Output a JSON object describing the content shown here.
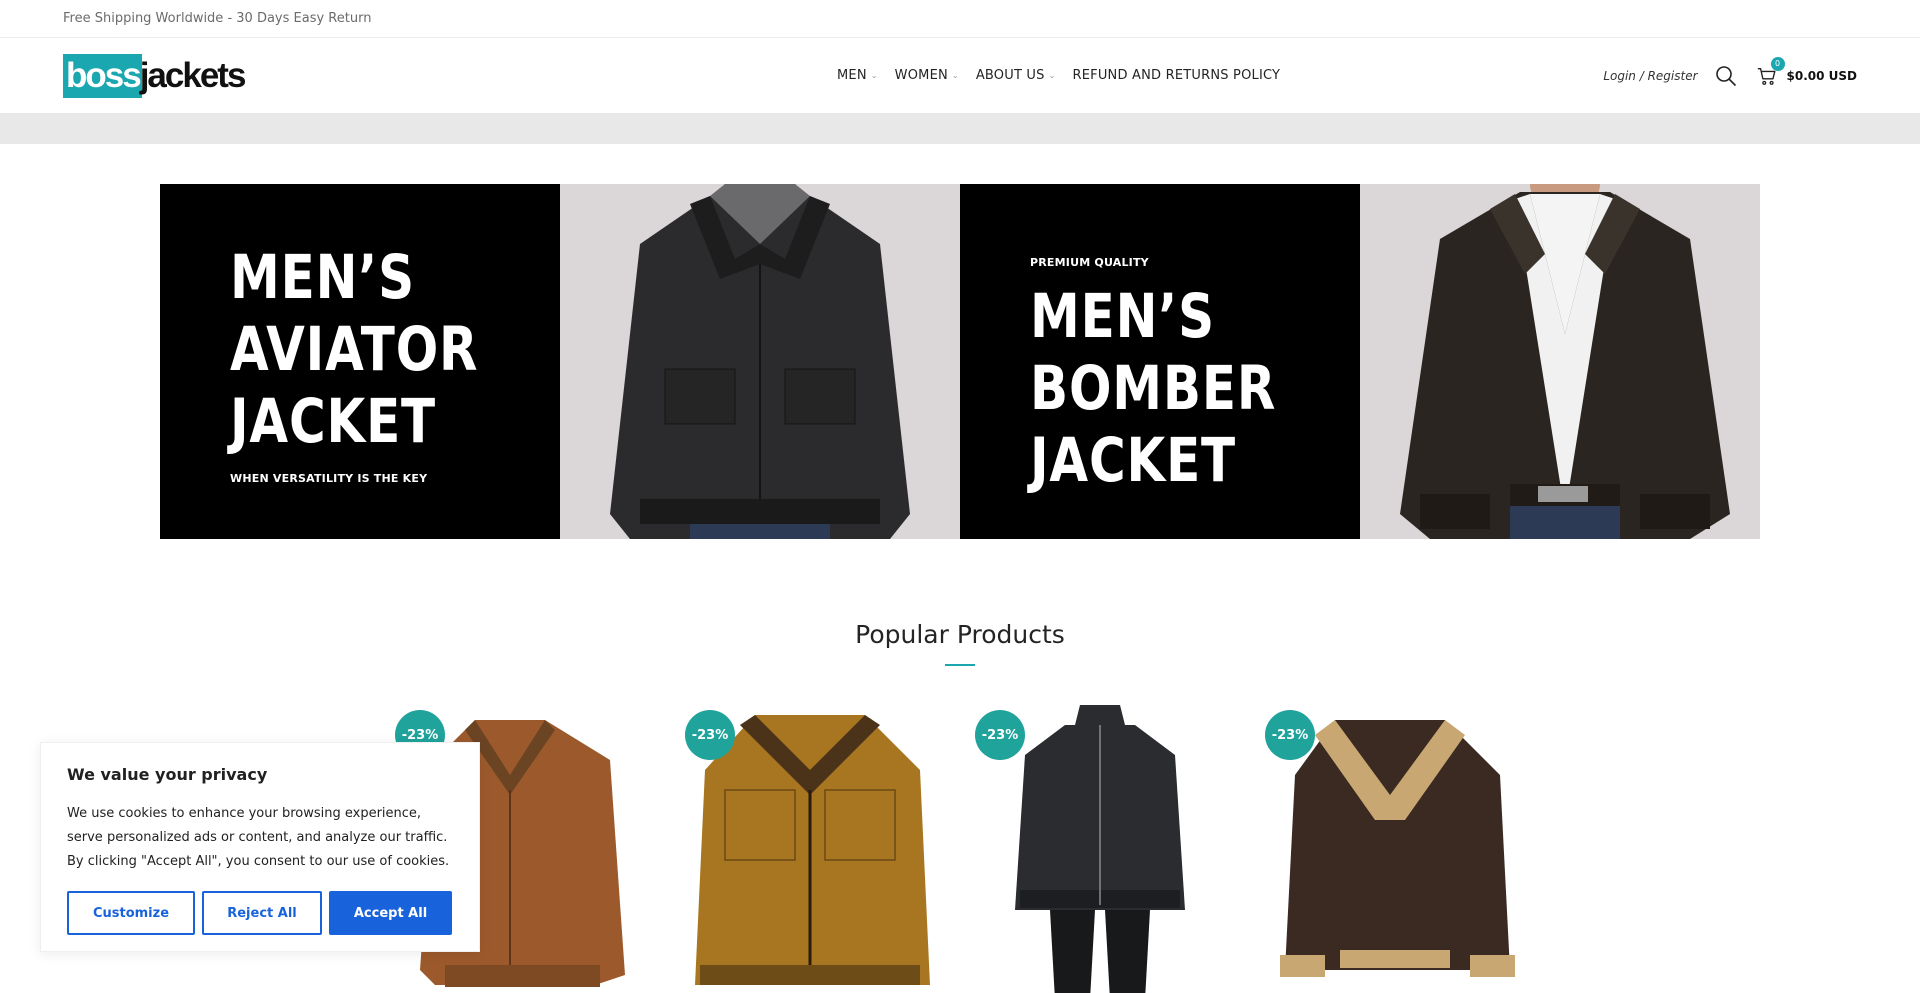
{
  "topbar": {
    "text": "Free Shipping Worldwide - 30 Days Easy Return"
  },
  "logo": {
    "part1": "boss",
    "part2": "jackets"
  },
  "nav": [
    {
      "label": "MEN",
      "dropdown": true
    },
    {
      "label": "WOMEN",
      "dropdown": true
    },
    {
      "label": "ABOUT US",
      "dropdown": true
    },
    {
      "label": "REFUND AND RETURNS POLICY",
      "dropdown": false
    }
  ],
  "header": {
    "login_label": "Login / Register",
    "cart_count": "0",
    "cart_total": "$0.00 USD"
  },
  "banner": {
    "left": {
      "title": "MEN’S AVIATOR JACKET",
      "subtitle": "WHEN VERSATILITY IS THE KEY"
    },
    "right": {
      "kicker": "PREMIUM QUALITY",
      "title": "MEN’S BOMBER JACKET"
    }
  },
  "products": {
    "section_title": "Popular Products",
    "items": [
      {
        "badge": "-23%",
        "jacket_color": "#9c5a2c"
      },
      {
        "badge": "-23%",
        "jacket_color": "#a87620"
      },
      {
        "badge": "-23%",
        "jacket_color": "#2a2c30"
      },
      {
        "badge": "-23%",
        "jacket_color": "#3a2a22"
      }
    ]
  },
  "cookie": {
    "title": "We value your privacy",
    "body": "We use cookies to enhance your browsing experience, serve personalized ads or content, and analyze our traffic. By clicking \"Accept All\", you consent to our use of cookies.",
    "customize_label": "Customize",
    "reject_label": "Reject All",
    "accept_label": "Accept All"
  },
  "colors": {
    "brand": "#1aa7b0",
    "badge": "#1fa39b",
    "cookie_blue": "#1863dc",
    "greyband": "#e8e8e8"
  }
}
